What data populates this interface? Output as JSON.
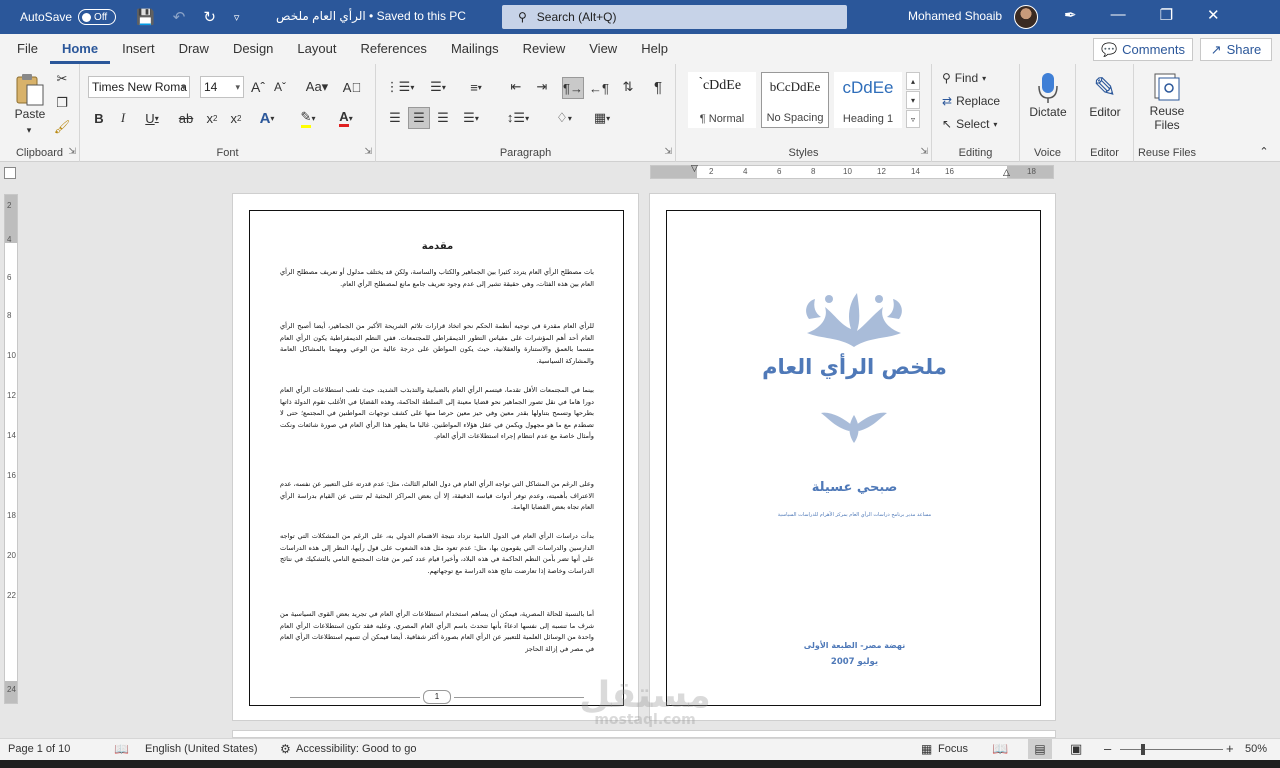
{
  "titlebar": {
    "autosave_label": "AutoSave",
    "autosave_state": "Off",
    "document_title": "الرأي العام ملخص • Saved to this PC",
    "search_label": "Search (Alt+Q)",
    "user_name": "Mohamed Shoaib"
  },
  "menu": {
    "tabs": [
      "File",
      "Home",
      "Insert",
      "Draw",
      "Design",
      "Layout",
      "References",
      "Mailings",
      "Review",
      "View",
      "Help"
    ],
    "comments_label": "Comments",
    "share_label": "Share"
  },
  "ribbon": {
    "clipboard": {
      "paste_label": "Paste",
      "group_label": "Clipboard"
    },
    "font": {
      "font_name": "Times New Roma",
      "font_size": "14",
      "group_label": "Font"
    },
    "paragraph": {
      "group_label": "Paragraph"
    },
    "styles": {
      "group_label": "Styles",
      "items": [
        {
          "preview": "̀cDdEe",
          "name": "¶ Normal"
        },
        {
          "preview": "bCcDdEe",
          "name": "No Spacing"
        },
        {
          "preview": "cDdEe",
          "name": "Heading 1"
        }
      ]
    },
    "editing": {
      "find_label": "Find",
      "replace_label": "Replace",
      "select_label": "Select",
      "group_label": "Editing"
    },
    "voice": {
      "dictate_label": "Dictate",
      "group_label": "Voice"
    },
    "editor": {
      "editor_label": "Editor",
      "group_label": "Editor"
    },
    "reuse": {
      "label_line1": "Reuse",
      "label_line2": "Files",
      "group_label": "Reuse Files"
    }
  },
  "ruler": {
    "h_ticks": [
      "2",
      "4",
      "6",
      "8",
      "10",
      "12",
      "14",
      "16",
      "18"
    ],
    "v_ticks": [
      "2",
      "4",
      "6",
      "8",
      "10",
      "12",
      "14",
      "16",
      "18",
      "20",
      "22",
      "24"
    ]
  },
  "doc_left": {
    "title": "مقدمة",
    "paragraphs": [
      "بات مصطلح الرأي العام يتردد كثيرا بين الجماهير والكتاب والساسة، ولكن قد يختلف مدلول أو تعريف مصطلح الرأي العام بين هذه الفئات، وهي حقيقة تشير إلى عدم وجود تعريف جامع مانع لمصطلح الرأي العام.",
      "للرأي العام مقدرة في توجيه أنظمة الحكم نحو اتخاذ قرارات تلائم الشريحة الأكبر من الجماهير، أيضا أصبح الرأي العام أحد أهم المؤشرات على مقياس التطور الديمقراطي للمجتمعات. ففي النظم الديمقراطية يكون الرأي العام متسما بالعمق والاستنارة والعقلانية، حيث يكون المواطن على درجة عالية من الوعي ومهتما بالمشاكل العامة والمشاركة السياسية.",
      "بينما في المجتمعات الأقل تقدما، فيتسم الرأي العام بالضبابية والتذبذب الشديد، حيث تلعب استطلاعات الرأي العام دورا هاما في نقل تصور الجماهير نحو قضايا معينة إلى السلطة الحاكمة، وهذه القضايا في الأغلب تقوم الدولة ذاتها بطرحها وتسمح بتناولها بقدر معين وفي حيز معين حرصا منها على كشف توجهات المواطنين في المجتمع؛ حتى لا تصطدم مع ما هو مجهول ويكمن في عقل هؤلاء المواطنين. غالبا ما يظهر هذا الرأي العام في صورة شائعات ونكت وأمثال خاصة مع عدم انتظام إجراء استطلاعات الرأي العام.",
      "وعلى الرغم من المشاكل التي تواجه الرأي العام في دول العالم الثالث، مثل: عدم قدرته على التعبير عن نفسه، عدم الاعتراف بأهميته، وعدم توفر أدوات قياسه الدقيقة، إلا أن بعض المراكز البحثية لم تتثنى عن القيام بدراسة الرأي العام تجاه بعض القضايا الهامة.",
      "بدأت دراسات الرأي العام في الدول النامية تزداد نتيجة الاهتمام الدولي به، على الرغم من المشكلات التي تواجه الدارسين والدراسات التي يقومون بها، مثل: عدم تعود مثل هذه الشعوب على قول رأيها، النظر إلى هذه الدراسات على أنها تضر بأمن النظم الحاكمة في هذه البلاد، وأخيرا قيام عدد كبير من فئات المجتمع النامي بالتشكيك في نتائج الدراسات وخاصة إذا تعارضت نتائج هذه الدراسة مع توجهاتهم.",
      "أما بالنسبة للحالة المصرية، فيمكن أن يساهم استخدام استطلاعات الرأي العام في تجريد بعض القوى السياسية من شرف ما تنسبه إلى نفسها ادعاءً بأنها تتحدث باسم الرأي العام المصري. وعليه فقد تكون استطلاعات الرأي العام واحدة من الوسائل العلمية للتعبير عن الرأي العام بصورة أكثر شفافية. أيضا فيمكن أن تسهم استطلاعات الرأي العام في مصر في إزالة الحاجز"
    ],
    "page_number": "1"
  },
  "doc_right": {
    "title": "ملخص الرأي العام",
    "author": "صبحي عسيلة",
    "author_desc": "مساعد مدير برنامج دراسات الرأي العام بمركز الأهرام للدراسات السياسية",
    "publisher": "نهضة مصر- الطبعة الأولى",
    "date": "يوليو 2007",
    "accent_color": "#4f79b8"
  },
  "watermark": {
    "arabic": "مستقل",
    "latin": "mostaql.com"
  },
  "statusbar": {
    "page_info": "Page 1 of 10",
    "language": "English (United States)",
    "accessibility": "Accessibility: Good to go",
    "focus_label": "Focus",
    "zoom_level": "50%",
    "zoom_fraction": 0.5
  }
}
